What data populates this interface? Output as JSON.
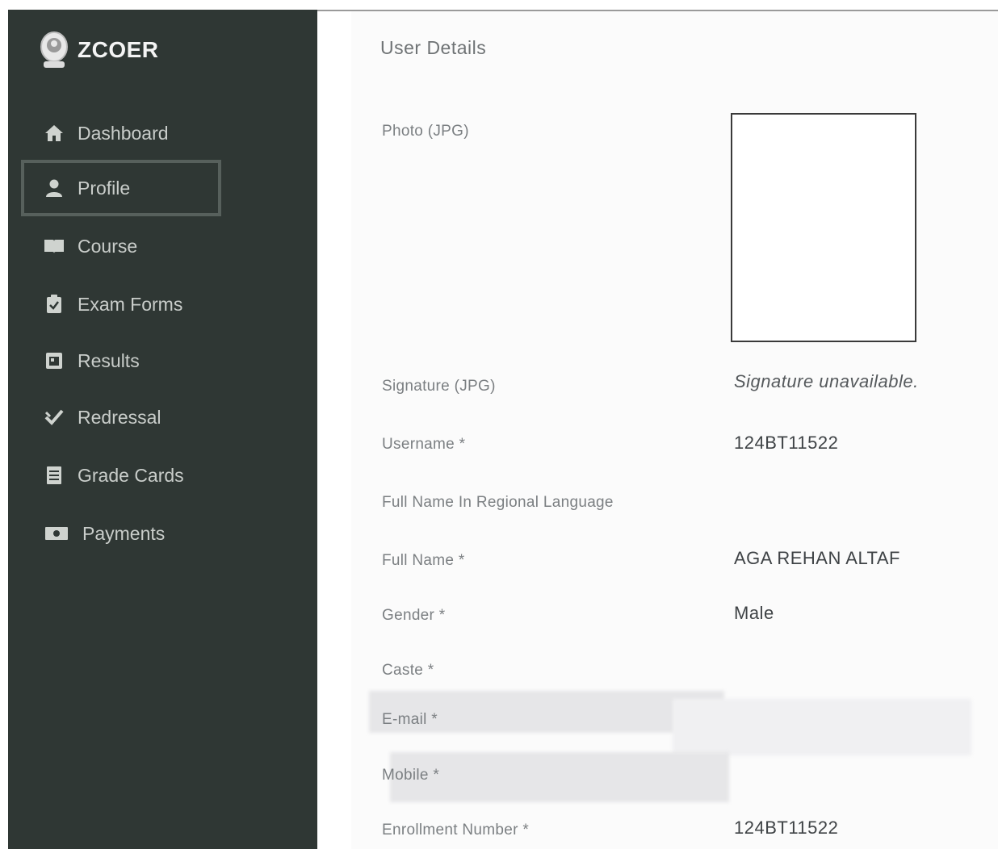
{
  "brand": {
    "name": "ZCOER",
    "logo_icon": "college-emblem-icon"
  },
  "sidebar": {
    "items": [
      {
        "label": "Dashboard",
        "icon": "home-icon",
        "active": false
      },
      {
        "label": "Profile",
        "icon": "user-icon",
        "active": true
      },
      {
        "label": "Course",
        "icon": "book-icon",
        "active": false
      },
      {
        "label": "Exam Forms",
        "icon": "clipboard-icon",
        "active": false
      },
      {
        "label": "Results",
        "icon": "calendar-icon",
        "active": false
      },
      {
        "label": "Redressal",
        "icon": "check-icon",
        "active": false
      },
      {
        "label": "Grade Cards",
        "icon": "list-icon",
        "active": false
      },
      {
        "label": "Payments",
        "icon": "money-icon",
        "active": false
      }
    ]
  },
  "user_details": {
    "title": "User Details",
    "photo_label": "Photo (JPG)",
    "signature_label": "Signature (JPG)",
    "signature_value": "Signature unavailable.",
    "username_label": "Username *",
    "username_value": "124BT11522",
    "regional_name_label": "Full Name In Regional Language",
    "regional_name_value": "",
    "full_name_label": "Full Name *",
    "full_name_value": "AGA REHAN ALTAF",
    "gender_label": "Gender *",
    "gender_value": "Male",
    "caste_label": "Caste *",
    "caste_value": "",
    "email_label": "E-mail *",
    "mobile_label": "Mobile *",
    "enrollment_label": "Enrollment Number *",
    "enrollment_value": "124BT11522"
  },
  "colors": {
    "sidebar_bg": "#2f3734",
    "active_border": "#57605c",
    "main_bg": "#ffffff"
  }
}
